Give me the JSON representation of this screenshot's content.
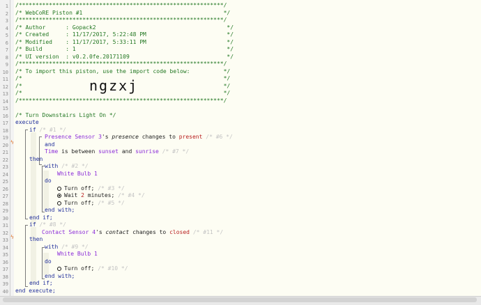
{
  "header": {
    "border_line": "/*************************************************************/",
    "title_line": "/* WebCoRE Piston #1                                          */",
    "author_line": "/* Author      : Gopack2                                       */",
    "created_line": "/* Created     : 11/17/2017, 5:22:48 PM                        */",
    "modified_line": "/* Modified    : 11/17/2017, 5:33:11 PM                        */",
    "build_line": "/* Build       : 1                                             */",
    "uiversion_line": "/* UI version  : v0.2.0fe.20171109                             */",
    "import_line": "/* To import this piston, use the import code below:          */",
    "blank_line": "/*                                                            */",
    "import_code": "ngzxj"
  },
  "code": {
    "comment_turn_on": "/* Turn Downstairs Light On */",
    "execute": "execute",
    "end_execute": "end execute;",
    "if": "if",
    "then": "then",
    "and": "and",
    "do": "do",
    "with": "with",
    "end_if": "end if;",
    "end_with": "end with;",
    "if1_tag": "/* #1 */",
    "cond1_device": "Presence Sensor 3",
    "cond1_possessive": "'s",
    "cond1_attr": "presence",
    "cond1_verb": "changes to",
    "cond1_value": "present",
    "cond1_tag": "/* #6 */",
    "cond2_device": "Time",
    "cond2_verb": "is between",
    "cond2_from": "sunset",
    "cond2_and": "and",
    "cond2_to": "sunrise",
    "cond2_tag": "/* #7 */",
    "with1_tag": "/* #2 */",
    "with1_device": "White Bulb 1",
    "task_off1": "Turn off;",
    "task_off1_tag": "/* #3 */",
    "task_wait_pre": "Wait",
    "task_wait_num": "2",
    "task_wait_post": "minutes;",
    "task_wait_tag": "/* #4 */",
    "task_off2": "Turn off;",
    "task_off2_tag": "/* #5 */",
    "if2_tag": "/* #8 */",
    "cond3_device": "Contact Sensor 4",
    "cond3_possessive": "'s",
    "cond3_attr": "contact",
    "cond3_verb": "changes to",
    "cond3_value": "closed",
    "cond3_tag": "/* #11 */",
    "with2_tag": "/* #9 */",
    "with2_device": "White Bulb 1",
    "task_off3": "Turn off;",
    "task_off3_tag": "/* #10 */"
  },
  "line_numbers": [
    "1",
    "2",
    "3",
    "4",
    "5",
    "6",
    "7",
    "8",
    "9",
    "10",
    "11",
    "12",
    "13",
    "14",
    "15",
    "16",
    "17",
    "18",
    "19",
    "20",
    "21",
    "22",
    "23",
    "24",
    "25",
    "26",
    "27",
    "28",
    "29",
    "30",
    "31",
    "32",
    "33",
    "34",
    "35",
    "36",
    "37",
    "38",
    "39",
    "40"
  ],
  "marks": {
    "line19": "ϟ",
    "line32": "ϟ"
  },
  "colors": {
    "background": "#fdfdf3",
    "comment": "#227722",
    "keyword": "#1f2d9a",
    "device": "#8a2bd8",
    "value": "#b81e1e",
    "faded_comment": "#c4c4c4",
    "trigger_mark": "#e0762a"
  }
}
